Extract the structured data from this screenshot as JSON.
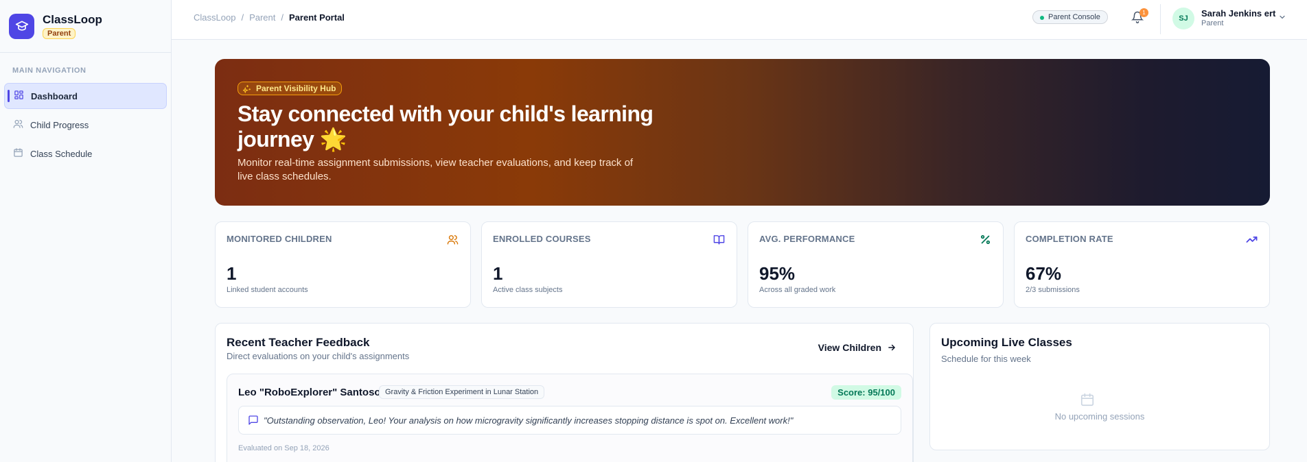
{
  "brand": {
    "name": "ClassLoop",
    "role": "Parent"
  },
  "sidebar": {
    "heading": "MAIN NAVIGATION",
    "items": [
      {
        "label": "Dashboard",
        "icon": "dashboard-icon",
        "active": true
      },
      {
        "label": "Child Progress",
        "icon": "users-icon",
        "active": false
      },
      {
        "label": "Class Schedule",
        "icon": "calendar-icon",
        "active": false
      }
    ]
  },
  "topbar": {
    "breadcrumb": [
      "ClassLoop",
      "Parent",
      "Parent Portal"
    ],
    "console_label": "Parent Console",
    "notification_count": "1",
    "user": {
      "initials": "SJ",
      "name": "Sarah Jenkins ert",
      "role": "Parent"
    }
  },
  "hero": {
    "chip": "Parent Visibility Hub",
    "title": "Stay connected with your child's learning journey 🌟",
    "description": "Monitor real-time assignment submissions, view teacher evaluations, and keep track of live class schedules."
  },
  "stats": [
    {
      "label": "MONITORED CHILDREN",
      "value": "1",
      "sub": "Linked student accounts",
      "icon": "users-icon",
      "color": "#d97706"
    },
    {
      "label": "ENROLLED COURSES",
      "value": "1",
      "sub": "Active class subjects",
      "icon": "book-icon",
      "color": "#4f46e5"
    },
    {
      "label": "AVG. PERFORMANCE",
      "value": "95%",
      "sub": "Across all graded work",
      "icon": "percent-icon",
      "color": "#047857"
    },
    {
      "label": "COMPLETION RATE",
      "value": "67%",
      "sub": "2/3 submissions",
      "icon": "trending-up-icon",
      "color": "#4f46e5"
    }
  ],
  "feedback": {
    "title": "Recent Teacher Feedback",
    "subtitle": "Direct evaluations on your child's assignments",
    "view_label": "View Children",
    "items": [
      {
        "student": "Leo \"RoboExplorer\" Santoso",
        "assignment": "Gravity & Friction Experiment in Lunar Station",
        "score": "Score: 95/100",
        "comment": "\"Outstanding observation, Leo! Your analysis on how microgravity significantly increases stopping distance is spot on. Excellent work!\"",
        "evaluated": "Evaluated on Sep 18, 2026"
      }
    ]
  },
  "live_classes": {
    "title": "Upcoming Live Classes",
    "subtitle": "Schedule for this week",
    "empty": "No upcoming sessions"
  }
}
